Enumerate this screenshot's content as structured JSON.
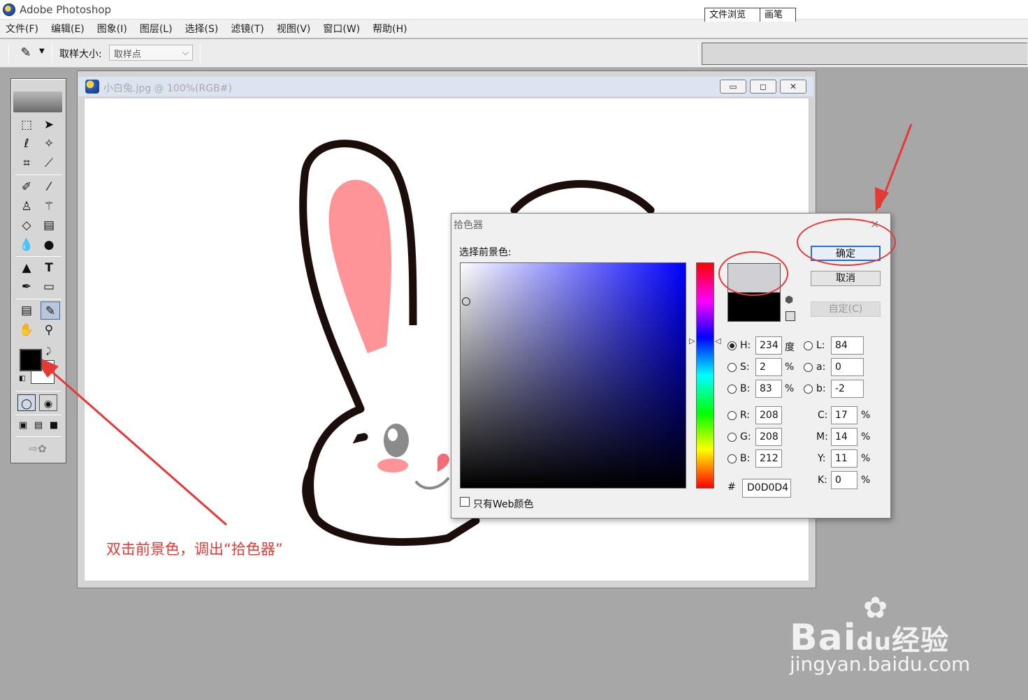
{
  "app": {
    "title": "Adobe Photoshop"
  },
  "menu": [
    "文件(F)",
    "编辑(E)",
    "图象(I)",
    "图层(L)",
    "选择(S)",
    "滤镜(T)",
    "视图(V)",
    "窗口(W)",
    "帮助(H)"
  ],
  "options": {
    "sample_label": "取样大小:",
    "sample_value": "取样点"
  },
  "palette_well": {
    "tabs": [
      "文件浏览",
      "画笔"
    ]
  },
  "document": {
    "title": "小白兔.jpg @ 100%(RGB#)"
  },
  "picker": {
    "title": "拾色器",
    "select_label": "选择前景色:",
    "buttons": {
      "ok": "确定",
      "cancel": "取消",
      "custom": "自定(C)"
    },
    "fields": {
      "H": {
        "label": "H:",
        "value": "234",
        "unit": "度"
      },
      "S": {
        "label": "S:",
        "value": "2",
        "unit": "%"
      },
      "B": {
        "label": "B:",
        "value": "83",
        "unit": "%"
      },
      "R": {
        "label": "R:",
        "value": "208"
      },
      "G": {
        "label": "G:",
        "value": "208"
      },
      "Bl": {
        "label": "B:",
        "value": "212"
      },
      "L": {
        "label": "L:",
        "value": "84"
      },
      "a": {
        "label": "a:",
        "value": "0"
      },
      "b": {
        "label": "b:",
        "value": "-2"
      },
      "C": {
        "label": "C:",
        "value": "17",
        "unit": "%"
      },
      "M": {
        "label": "M:",
        "value": "14",
        "unit": "%"
      },
      "Y": {
        "label": "Y:",
        "value": "11",
        "unit": "%"
      },
      "K": {
        "label": "K:",
        "value": "0",
        "unit": "%"
      }
    },
    "hex_label": "#",
    "hex": "D0D0D4",
    "web_only_label": "只有Web颜色",
    "new_color": "#d0d0d4",
    "old_color": "#000000"
  },
  "annotation": "双击前景色，调出“拾色器”",
  "watermark": {
    "brand": "Bai",
    "brand_tail": "du",
    "brand_cn": "经验",
    "url": "jingyan.baidu.com"
  },
  "colors": {
    "accent_red": "#e53935",
    "ok_border": "#2a6dc6"
  }
}
